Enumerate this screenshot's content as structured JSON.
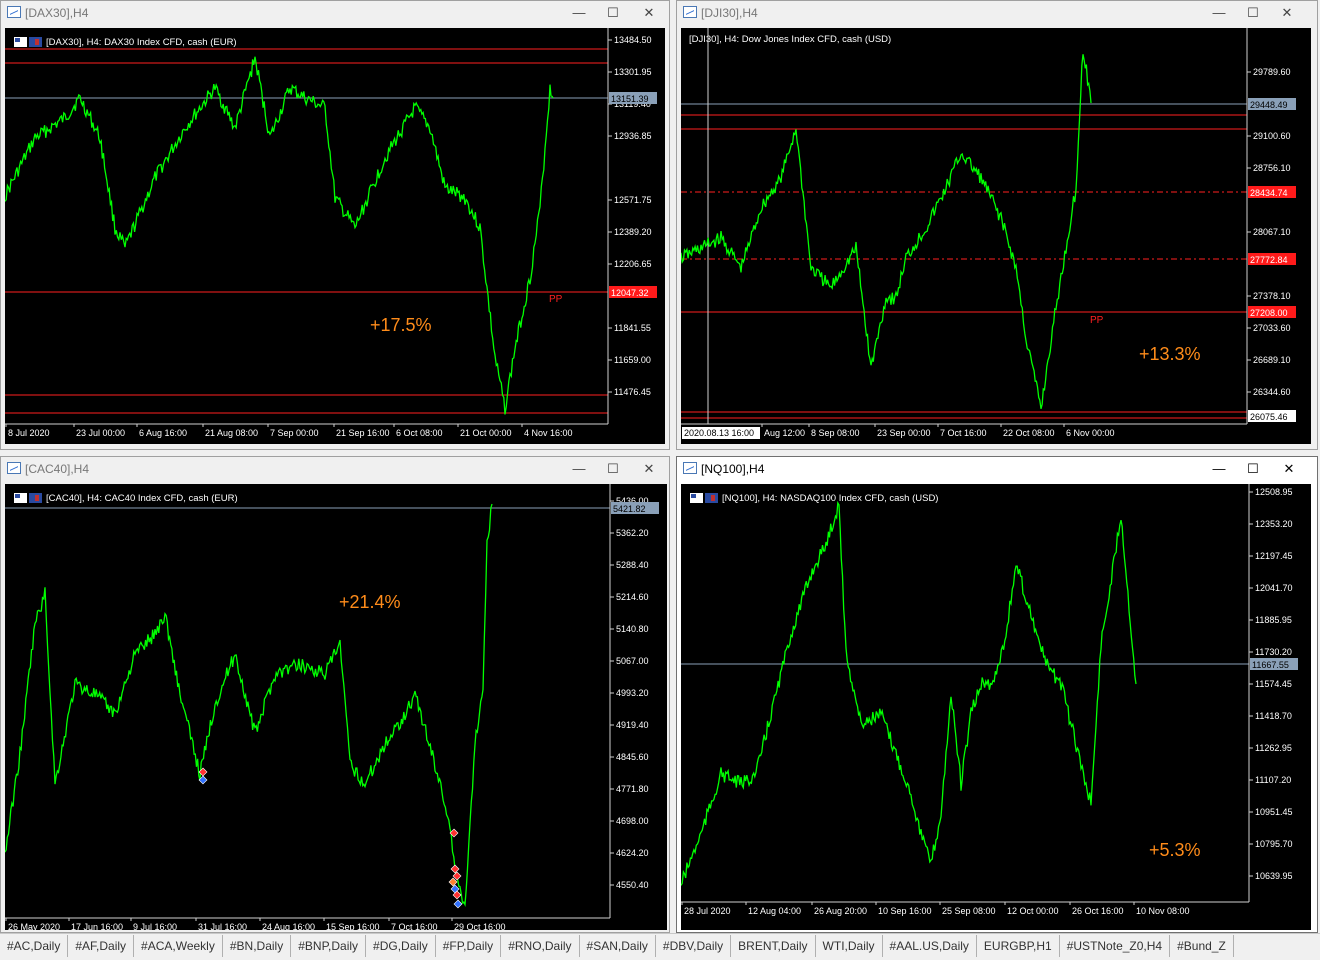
{
  "windows": [
    {
      "id": "dax",
      "title": "[DAX30],H4",
      "header": "[DAX30], H4:  DAX30 Index CFD, cash (EUR)",
      "price_labels": [
        "13484.50",
        "13301.95",
        "13119.40",
        "12936.85",
        "12571.75",
        "12389.20",
        "12206.65",
        "11841.55",
        "11659.00",
        "11476.45"
      ],
      "current_price": "13151.39",
      "red_price": "12047.32",
      "time_labels": [
        "8 Jul 2020",
        "23 Jul 00:00",
        "6 Aug 16:00",
        "21 Aug 08:00",
        "7 Sep 00:00",
        "21 Sep 16:00",
        "6 Oct 08:00",
        "21 Oct 00:00",
        "4 Nov 16:00"
      ],
      "pp_label": "PP",
      "change_text": "+17.5%",
      "colors": {
        "line": "#00ff00",
        "levels": "#ff2020",
        "change": "#ff8c1a"
      },
      "controls": {
        "minimize": "—",
        "maximize": "☐",
        "close": "✕"
      }
    },
    {
      "id": "dji",
      "title": "[DJI30],H4",
      "header": "[DJI30], H4:  Dow Jones Index CFD, cash (USD)",
      "price_labels": [
        "29789.60",
        "29100.60",
        "28756.10",
        "28067.10",
        "27378.10",
        "27033.60",
        "26689.10",
        "26344.60"
      ],
      "current_price": "29448.49",
      "red_prices": [
        "28434.74",
        "27772.84",
        "27208.00"
      ],
      "bottom_price": "26075.46",
      "time_labels": [
        "2020.08.13 16:00",
        "Aug 12:00",
        "8 Sep 08:00",
        "23 Sep 00:00",
        "7 Oct 16:00",
        "22 Oct 08:00",
        "6 Nov 00:00"
      ],
      "pp_label": "PP",
      "change_text": "+13.3%",
      "colors": {
        "line": "#00ff00",
        "levels": "#ff2020",
        "change": "#ff8c1a"
      },
      "controls": {
        "minimize": "—",
        "maximize": "☐",
        "close": "✕"
      }
    },
    {
      "id": "cac",
      "title": "[CAC40],H4",
      "header": "[CAC40], H4:  CAC40 Index CFD, cash (EUR)",
      "price_labels": [
        "5436.00",
        "5362.20",
        "5288.40",
        "5214.60",
        "5140.80",
        "5067.00",
        "4993.20",
        "4919.40",
        "4845.60",
        "4771.80",
        "4698.00",
        "4624.20",
        "4550.40"
      ],
      "current_price": "5421.82",
      "time_labels": [
        "26 May 2020",
        "17 Jun 16:00",
        "9 Jul 16:00",
        "31 Jul 16:00",
        "24 Aug 16:00",
        "15 Sep 16:00",
        "7 Oct 16:00",
        "29 Oct 16:00"
      ],
      "change_text": "+21.4%",
      "colors": {
        "line": "#00ff00",
        "change": "#ff8c1a"
      },
      "controls": {
        "minimize": "—",
        "maximize": "☐",
        "close": "✕"
      }
    },
    {
      "id": "nq",
      "title": "[NQ100],H4",
      "header": "[NQ100], H4:  NASDAQ100 Index CFD, cash (USD)",
      "price_labels": [
        "12508.95",
        "12353.20",
        "12197.45",
        "12041.70",
        "11885.95",
        "11730.20",
        "11574.45",
        "11418.70",
        "11262.95",
        "11107.20",
        "10951.45",
        "10795.70",
        "10639.95"
      ],
      "current_price": "11667.55",
      "time_labels": [
        "28 Jul 2020",
        "12 Aug 04:00",
        "26 Aug 20:00",
        "10 Sep 16:00",
        "25 Sep 08:00",
        "12 Oct 00:00",
        "26 Oct 16:00",
        "10 Nov 08:00"
      ],
      "change_text": "+5.3%",
      "colors": {
        "line": "#00ff00",
        "change": "#ff8c1a"
      },
      "controls": {
        "minimize": "—",
        "maximize": "☐",
        "close": "✕"
      }
    }
  ],
  "tabs": [
    "#AC,Daily",
    "#AF,Daily",
    "#ACA,Weekly",
    "#BN,Daily",
    "#BNP,Daily",
    "#DG,Daily",
    "#FP,Daily",
    "#RNO,Daily",
    "#SAN,Daily",
    "#DBV,Daily",
    "BRENT,Daily",
    "WTI,Daily",
    "#AAL.US,Daily",
    "EURGBP,H1",
    "#USTNote_Z0,H4",
    "#Bund_Z"
  ],
  "icons": {
    "window": "chart-window-icon",
    "flag": "flag-icon"
  }
}
